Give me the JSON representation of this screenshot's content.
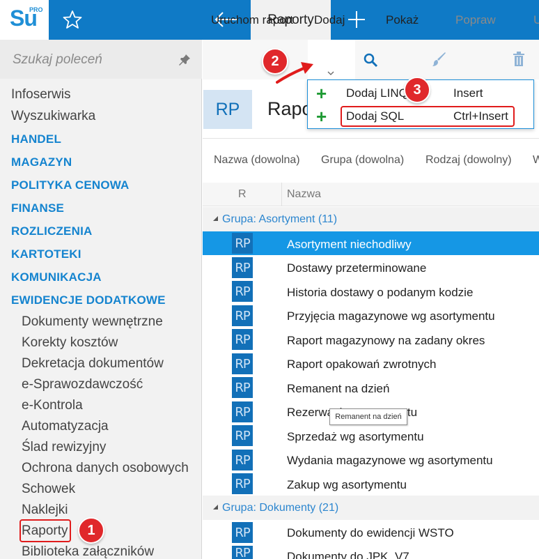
{
  "app": {
    "logo_text": "Su",
    "logo_sup": "PRO",
    "active_tab": "Raporty"
  },
  "sidebar": {
    "search_placeholder": "Szukaj poleceń",
    "items": [
      {
        "label": "Infoserwis",
        "kind": "top"
      },
      {
        "label": "Wyszukiwarka",
        "kind": "top"
      },
      {
        "label": "HANDEL",
        "kind": "cat"
      },
      {
        "label": "MAGAZYN",
        "kind": "cat"
      },
      {
        "label": "POLITYKA CENOWA",
        "kind": "cat"
      },
      {
        "label": "FINANSE",
        "kind": "cat"
      },
      {
        "label": "ROZLICZENIA",
        "kind": "cat"
      },
      {
        "label": "KARTOTEKI",
        "kind": "cat"
      },
      {
        "label": "KOMUNIKACJA",
        "kind": "cat"
      },
      {
        "label": "EWIDENCJE DODATKOWE",
        "kind": "cat"
      },
      {
        "label": "Dokumenty wewnętrzne",
        "kind": "sub"
      },
      {
        "label": "Korekty kosztów",
        "kind": "sub"
      },
      {
        "label": "Dekretacja dokumentów",
        "kind": "sub"
      },
      {
        "label": "e-Sprawozdawczość",
        "kind": "sub"
      },
      {
        "label": "e-Kontrola",
        "kind": "sub"
      },
      {
        "label": "Automatyzacja",
        "kind": "sub"
      },
      {
        "label": "Ślad rewizyjny",
        "kind": "sub"
      },
      {
        "label": "Ochrona danych osobowych",
        "kind": "sub"
      },
      {
        "label": "Schowek",
        "kind": "sub"
      },
      {
        "label": "Naklejki",
        "kind": "sub"
      },
      {
        "label": "Raporty",
        "kind": "sub"
      },
      {
        "label": "Biblioteka załączników",
        "kind": "sub"
      }
    ]
  },
  "ribbon": {
    "run": "Uruchom raport",
    "add": "Dodaj",
    "show": "Pokaż",
    "edit": "Popraw",
    "delete": "U"
  },
  "dropdown": {
    "items": [
      {
        "label": "Dodaj LINQ",
        "shortcut": "Insert"
      },
      {
        "label": "Dodaj SQL",
        "shortcut": "Ctrl+Insert"
      }
    ]
  },
  "document": {
    "badge": "RP",
    "title": "Raporty"
  },
  "filters": [
    "Nazwa (dowolna)",
    "Grupa (dowolna)",
    "Rodzaj (dowolny)",
    "W"
  ],
  "grid": {
    "col_r": "R",
    "col_name": "Nazwa",
    "groups": [
      {
        "label": "Grupa: Asortyment (11)",
        "rows": [
          "Asortyment niechodliwy",
          "Dostawy przeterminowane",
          "Historia dostawy o podanym kodzie",
          "Przyjęcia magazynowe wg asortymentu",
          "Raport magazynowy na zadany okres",
          "Raport opakowań zwrotnych",
          "Remanent na dzień",
          "Rezerwacje asortymentu",
          "Sprzedaż wg asortymentu",
          "Wydania magazynowe wg asortymentu",
          "Zakup wg asortymentu"
        ]
      },
      {
        "label": "Grupa: Dokumenty (21)",
        "rows": [
          "Dokumenty do ewidencji WSTO",
          "Dokumenty do JPK_V7"
        ]
      }
    ],
    "row_icon": "RP",
    "selected_index": 0
  },
  "tooltip": "Remanent na dzień",
  "callouts": [
    "1",
    "2",
    "3"
  ],
  "colors": {
    "accent": "#0f7ac6",
    "selected": "#1597e5",
    "category": "#1584cf",
    "callout": "#e0282b",
    "plus": "#1f9a34"
  }
}
